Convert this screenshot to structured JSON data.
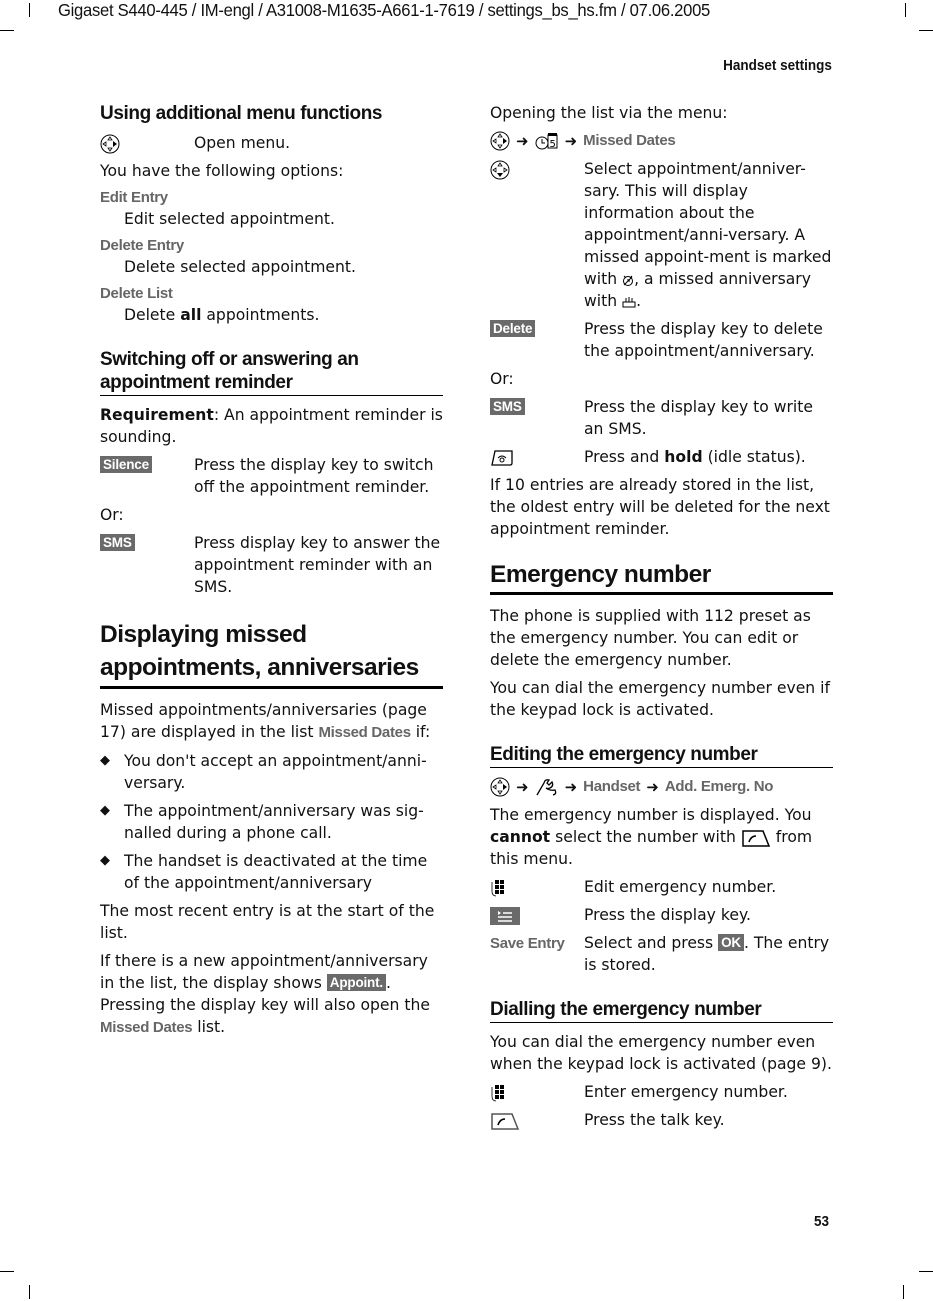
{
  "header": {
    "doc_line": "Gigaset S440-445 / IM-engl / A31008-M1635-A661-1-7619 / settings_bs_hs.fm / 07.06.2005",
    "running_title": "Handset settings",
    "page_number": "53"
  },
  "left": {
    "menu_functions": {
      "title": "Using additional menu functions",
      "open_icon": "control-key-right-icon",
      "open_text": "Open menu.",
      "intro": "You have the following options:",
      "options": [
        {
          "name": "Edit Entry",
          "desc": "Edit selected appointment."
        },
        {
          "name": "Delete Entry",
          "desc": "Delete selected appointment."
        },
        {
          "name": "Delete List",
          "desc_pre": "Delete ",
          "desc_bold": "all",
          "desc_post": " appointments."
        }
      ]
    },
    "switching_off": {
      "title": "Switching off or answering an appointment reminder",
      "req_bold": "Requirement",
      "req_text": ": An appointment reminder is sounding.",
      "silence_key": "Silence",
      "silence_text": "Press the display key to switch off the appointment reminder.",
      "or": "Or:",
      "sms_key": "SMS",
      "sms_text": "Press display key to answer the appointment reminder with an SMS."
    },
    "missed": {
      "title": "Displaying missed appointments, anniversaries",
      "intro_pre": "Missed appointments/anniversaries (page 17) are displayed in the list ",
      "intro_menu": "Missed Dates",
      "intro_post": " if:",
      "bullets": [
        "You don't accept an appointment/anni-versary.",
        "The appointment/anniversary was sig-nalled during a phone call.",
        "The handset is deactivated at the time of the appointment/anniversary"
      ],
      "recent": "The most recent entry is at the start of the list.",
      "new_pre": "If there is a new appointment/anniversary in the list, the display shows ",
      "new_key": "Appoint.",
      "new_mid": ". Pressing the display key will also open the ",
      "new_menu": "Missed Dates",
      "new_post": " list."
    }
  },
  "right": {
    "open_list": {
      "intro": "Opening the list via the menu:",
      "path_menu": "Missed Dates",
      "select_text": "Select appointment/anniver-sary. This will display information about the appointment/anni-versary. A missed appoint-ment is marked with",
      "select_mid": ", a missed anniversary with",
      "select_end": ".",
      "delete_key": "Delete",
      "delete_text": "Press the display key to delete the appointment/anniversary.",
      "or": "Or:",
      "sms_key": "SMS",
      "sms_text": "Press the display key to write an SMS.",
      "hold_pre": "Press and ",
      "hold_bold": "hold",
      "hold_post": " (idle status).",
      "note": "If 10 entries are already stored in the list, the oldest entry will be deleted for the next appointment reminder."
    },
    "emergency": {
      "title": "Emergency number",
      "p1": "The phone is supplied with 112 preset as the emergency number. You can edit or delete the emergency number.",
      "p2": "You can dial the emergency number even if the keypad lock is activated."
    },
    "editing": {
      "title": "Editing the emergency number",
      "path": [
        "Handset",
        "Add. Emerg. No"
      ],
      "p_pre": "The emergency number is displayed. You ",
      "p_bold": "cannot",
      "p_mid": " select the number with",
      "p_post": " from this menu.",
      "edit_text": "Edit emergency number.",
      "key_text": "Press the display key.",
      "save_name": "Save Entry",
      "save_pre": "Select and press ",
      "save_key": "OK",
      "save_post": ". The entry is stored."
    },
    "dialling": {
      "title": "Dialling the emergency number",
      "p": "You can dial the emergency number even when the keypad lock is activated (page 9).",
      "enter_text": "Enter emergency number.",
      "talk_text": "Press the talk key."
    }
  }
}
